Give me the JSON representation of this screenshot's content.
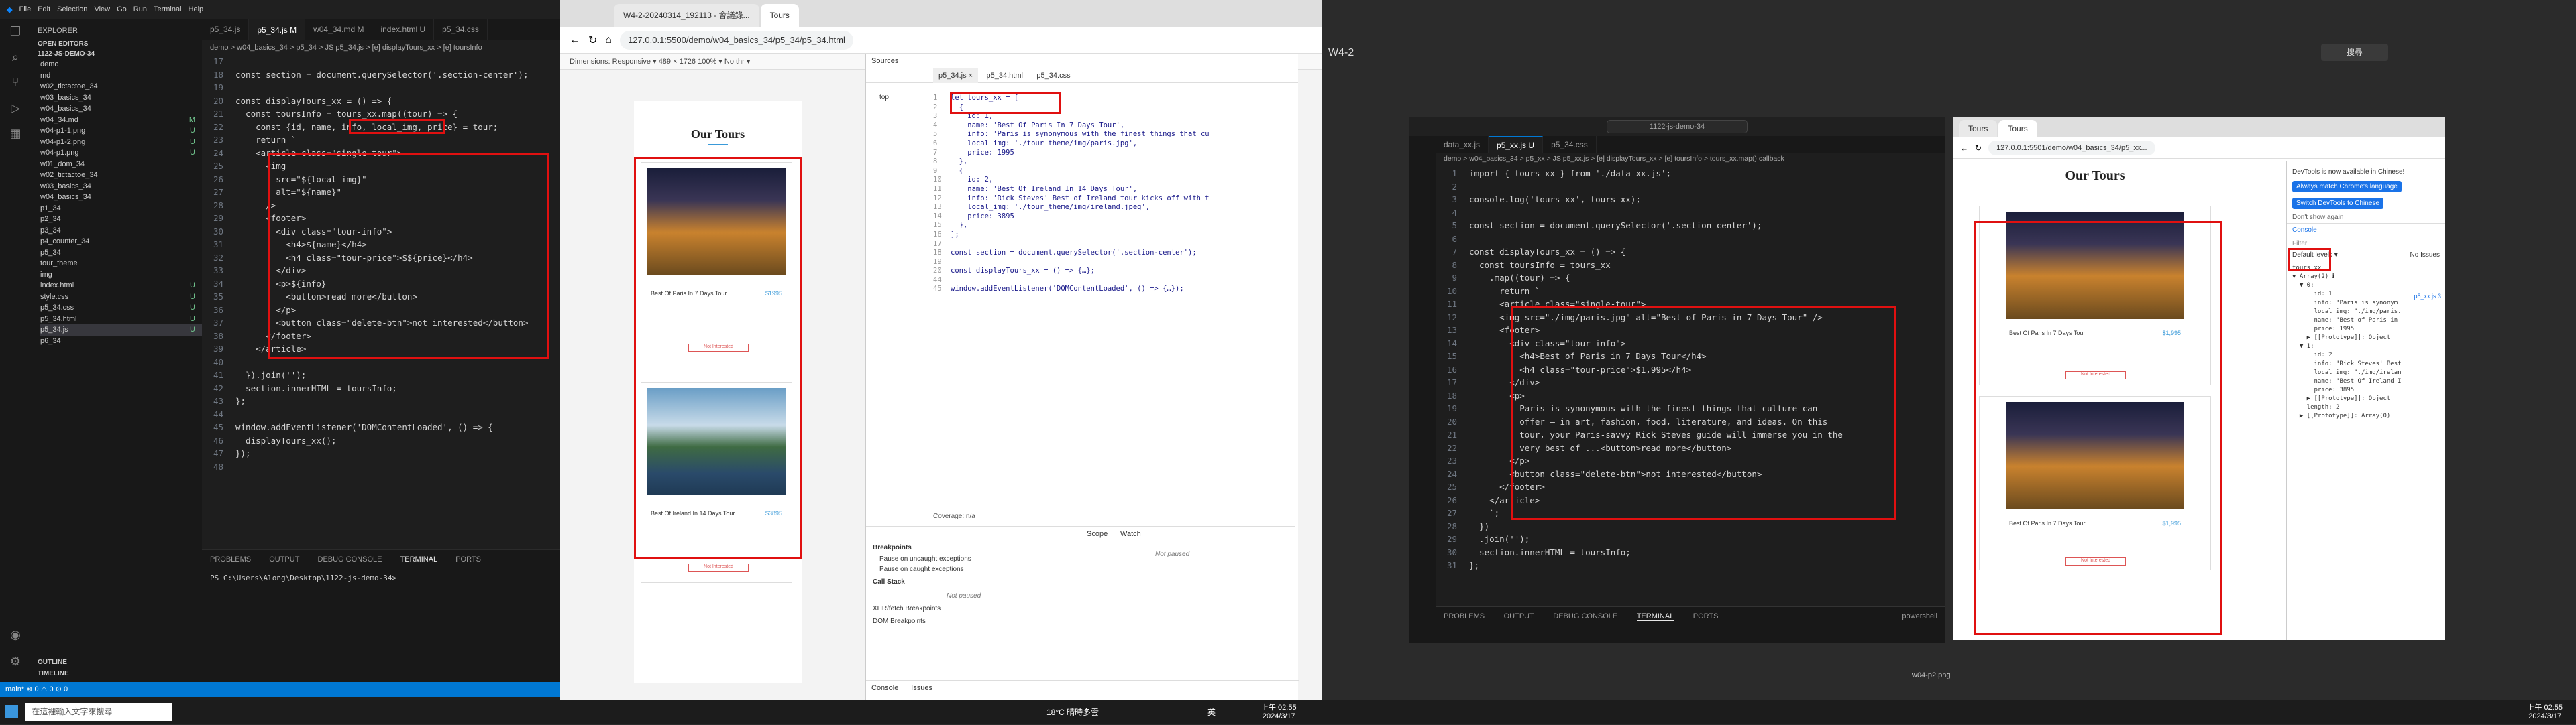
{
  "left_vscode": {
    "menu": [
      "File",
      "Edit",
      "Selection",
      "View",
      "Go",
      "Run",
      "Terminal",
      "Help"
    ],
    "explorer_title": "EXPLORER",
    "open_editors": "OPEN EDITORS",
    "workspace": "1122-JS-DEMO-34",
    "tree": [
      {
        "name": "demo",
        "status": ""
      },
      {
        "name": "md",
        "status": ""
      },
      {
        "name": "w02_tictactoe_34",
        "status": ""
      },
      {
        "name": "w03_basics_34",
        "status": ""
      },
      {
        "name": "w04_basics_34",
        "status": ""
      },
      {
        "name": "w04_34.md",
        "status": "M"
      },
      {
        "name": "w04-p1-1.png",
        "status": "U"
      },
      {
        "name": "w04-p1-2.png",
        "status": "U"
      },
      {
        "name": "w04-p1.png",
        "status": "U"
      },
      {
        "name": "w01_dom_34",
        "status": ""
      },
      {
        "name": "w02_tictactoe_34",
        "status": ""
      },
      {
        "name": "w03_basics_34",
        "status": ""
      },
      {
        "name": "w04_basics_34",
        "status": ""
      },
      {
        "name": "p1_34",
        "status": ""
      },
      {
        "name": "p2_34",
        "status": ""
      },
      {
        "name": "p3_34",
        "status": ""
      },
      {
        "name": "p4_counter_34",
        "status": ""
      },
      {
        "name": "p5_34",
        "status": ""
      },
      {
        "name": "tour_theme",
        "status": ""
      },
      {
        "name": "img",
        "status": ""
      },
      {
        "name": "index.html",
        "status": "U"
      },
      {
        "name": "style.css",
        "status": "U"
      },
      {
        "name": "p5_34.css",
        "status": "U"
      },
      {
        "name": "p5_34.html",
        "status": "U"
      },
      {
        "name": "p5_34.js",
        "status": "U"
      },
      {
        "name": "p6_34",
        "status": ""
      }
    ],
    "outline": "OUTLINE",
    "timeline": "TIMELINE",
    "tabs": [
      "p5_34.js",
      "p5_34.js M",
      "w04_34.md M",
      "index.html U",
      "p5_34.css"
    ],
    "breadcrumb": "demo > w04_basics_34 > p5_34 > JS p5_34.js > [e] displayTours_xx > [e] toursInfo",
    "code": [
      {
        "n": "17",
        "t": ""
      },
      {
        "n": "18",
        "t": "const section = document.querySelector('.section-center');"
      },
      {
        "n": "19",
        "t": ""
      },
      {
        "n": "20",
        "t": "const displayTours_xx = () => {"
      },
      {
        "n": "21",
        "t": "  const toursInfo = tours_xx.map((tour) => {"
      },
      {
        "n": "22",
        "t": "    const {id, name, info, local_img, price} = tour;"
      },
      {
        "n": "23",
        "t": "    return `"
      },
      {
        "n": "24",
        "t": "    <article class=\"single-tour\">"
      },
      {
        "n": "25",
        "t": "      <img"
      },
      {
        "n": "26",
        "t": "        src=\"${local_img}\""
      },
      {
        "n": "27",
        "t": "        alt=\"${name}\""
      },
      {
        "n": "28",
        "t": "      />"
      },
      {
        "n": "29",
        "t": "      <footer>"
      },
      {
        "n": "30",
        "t": "        <div class=\"tour-info\">"
      },
      {
        "n": "31",
        "t": "          <h4>${name}</h4>"
      },
      {
        "n": "32",
        "t": "          <h4 class=\"tour-price\">$${price}</h4>"
      },
      {
        "n": "33",
        "t": "        </div>"
      },
      {
        "n": "34",
        "t": "        <p>${info}"
      },
      {
        "n": "35",
        "t": "          <button>read more</button>"
      },
      {
        "n": "36",
        "t": "        </p>"
      },
      {
        "n": "37",
        "t": "        <button class=\"delete-btn\">not interested</button>"
      },
      {
        "n": "38",
        "t": "      </footer>"
      },
      {
        "n": "39",
        "t": "    </article>"
      },
      {
        "n": "40",
        "t": ""
      },
      {
        "n": "41",
        "t": "  }).join('');"
      },
      {
        "n": "42",
        "t": "  section.innerHTML = toursInfo;"
      },
      {
        "n": "43",
        "t": "};"
      },
      {
        "n": "44",
        "t": ""
      },
      {
        "n": "45",
        "t": "window.addEventListener('DOMContentLoaded', () => {"
      },
      {
        "n": "46",
        "t": "  displayTours_xx();"
      },
      {
        "n": "47",
        "t": "});"
      },
      {
        "n": "48",
        "t": ""
      }
    ],
    "panel_tabs": [
      "PROBLEMS",
      "OUTPUT",
      "DEBUG CONSOLE",
      "TERMINAL",
      "PORTS"
    ],
    "terminal": "PS C:\\Users\\Along\\Desktop\\1122-js-demo-34>",
    "status": "main*  ⊗ 0 ⚠ 0  ⊙ 0"
  },
  "browser1": {
    "tabs": [
      "W4-2-20240314_192113 - 會議錄...",
      "Tours"
    ],
    "url": "127.0.0.1:5500/demo/w04_basics_34/p5_34/p5_34.html",
    "device_toolbar": "Dimensions: Responsive ▾   489   ×   1726   100% ▾   No thr ▾",
    "page_title": "Our Tours",
    "card1": {
      "title": "Best Of Paris In 7 Days Tour",
      "price": "$1995",
      "button": "Not Interested"
    },
    "card2": {
      "title": "Best Of Ireland In 14 Days Tour",
      "price": "$3895",
      "button": "Not Interested"
    },
    "devtools": {
      "tabs": [
        "Sources"
      ],
      "file_tabs": [
        "p5_34.js ×",
        "p5_34.html",
        "p5_34.css"
      ],
      "nav_item": "top",
      "code": [
        {
          "n": "1",
          "t": "let tours_xx = ["
        },
        {
          "n": "2",
          "t": "  {"
        },
        {
          "n": "3",
          "t": "    id: 1,"
        },
        {
          "n": "4",
          "t": "    name: 'Best Of Paris In 7 Days Tour',"
        },
        {
          "n": "5",
          "t": "    info: 'Paris is synonymous with the finest things that cu"
        },
        {
          "n": "6",
          "t": "    local_img: './tour_theme/img/paris.jpg',"
        },
        {
          "n": "7",
          "t": "    price: 1995"
        },
        {
          "n": "8",
          "t": "  },"
        },
        {
          "n": "9",
          "t": "  {"
        },
        {
          "n": "10",
          "t": "    id: 2,"
        },
        {
          "n": "11",
          "t": "    name: 'Best Of Ireland In 14 Days Tour',"
        },
        {
          "n": "12",
          "t": "    info: 'Rick Steves' Best of Ireland tour kicks off with t"
        },
        {
          "n": "13",
          "t": "    local_img: './tour_theme/img/ireland.jpeg',"
        },
        {
          "n": "14",
          "t": "    price: 3895"
        },
        {
          "n": "15",
          "t": "  },"
        },
        {
          "n": "16",
          "t": "];"
        },
        {
          "n": "17",
          "t": ""
        },
        {
          "n": "18",
          "t": "const section = document.querySelector('.section-center');"
        },
        {
          "n": "19",
          "t": ""
        },
        {
          "n": "20",
          "t": "const displayTours_xx = () => {…};"
        },
        {
          "n": "44",
          "t": ""
        },
        {
          "n": "45",
          "t": "window.addEventListener('DOMContentLoaded', () => {…});"
        }
      ],
      "coverage": "Coverage: n/a",
      "debug_tabs": [
        "Scope",
        "Watch"
      ],
      "not_paused": "Not paused",
      "breakpoints": "Breakpoints",
      "pause_uncaught": "Pause on uncaught exceptions",
      "pause_caught": "Pause on caught exceptions",
      "call_stack": "Call Stack",
      "xhr": "XHR/fetch Breakpoints",
      "dom_bp": "DOM Breakpoints",
      "console_tabs": [
        "Console",
        "Issues"
      ]
    }
  },
  "right_vscode": {
    "search": "1122-js-demo-34",
    "tabs": [
      "data_xx.js",
      "p5_xx.js U",
      "p5_34.css"
    ],
    "breadcrumb": "demo > w04_basics_34 > p5_xx > JS p5_xx.js > [e] displayTours_xx > [e] toursInfo > tours_xx.map() callback",
    "code": [
      {
        "n": "1",
        "t": "import { tours_xx } from './data_xx.js';"
      },
      {
        "n": "2",
        "t": ""
      },
      {
        "n": "3",
        "t": "console.log('tours_xx', tours_xx);"
      },
      {
        "n": "4",
        "t": ""
      },
      {
        "n": "5",
        "t": "const section = document.querySelector('.section-center');"
      },
      {
        "n": "6",
        "t": ""
      },
      {
        "n": "7",
        "t": "const displayTours_xx = () => {"
      },
      {
        "n": "8",
        "t": "  const toursInfo = tours_xx"
      },
      {
        "n": "9",
        "t": "    .map((tour) => {"
      },
      {
        "n": "10",
        "t": "      return `"
      },
      {
        "n": "11",
        "t": "      <article class=\"single-tour\">"
      },
      {
        "n": "12",
        "t": "      <img src=\"./img/paris.jpg\" alt=\"Best of Paris in 7 Days Tour\" />"
      },
      {
        "n": "13",
        "t": "      <footer>"
      },
      {
        "n": "14",
        "t": "        <div class=\"tour-info\">"
      },
      {
        "n": "15",
        "t": "          <h4>Best of Paris in 7 Days Tour</h4>"
      },
      {
        "n": "16",
        "t": "          <h4 class=\"tour-price\">$1,995</h4>"
      },
      {
        "n": "17",
        "t": "        </div>"
      },
      {
        "n": "18",
        "t": "        <p>"
      },
      {
        "n": "19",
        "t": "          Paris is synonymous with the finest things that culture can"
      },
      {
        "n": "20",
        "t": "          offer — in art, fashion, food, literature, and ideas. On this"
      },
      {
        "n": "21",
        "t": "          tour, your Paris-savvy Rick Steves guide will immerse you in the"
      },
      {
        "n": "22",
        "t": "          very best of ...<button>read more</button>"
      },
      {
        "n": "23",
        "t": "        </p>"
      },
      {
        "n": "24",
        "t": "        <button class=\"delete-btn\">not interested</button>"
      },
      {
        "n": "25",
        "t": "      </footer>"
      },
      {
        "n": "26",
        "t": "    </article>"
      },
      {
        "n": "27",
        "t": "    `;"
      },
      {
        "n": "28",
        "t": "  })"
      },
      {
        "n": "29",
        "t": "  .join('');"
      },
      {
        "n": "30",
        "t": "  section.innerHTML = toursInfo;"
      },
      {
        "n": "31",
        "t": "};"
      }
    ],
    "panel_tabs": [
      "PROBLEMS",
      "OUTPUT",
      "DEBUG CONSOLE",
      "TERMINAL",
      "PORTS"
    ],
    "terminal_shell": "powershell"
  },
  "browser2": {
    "tabs": [
      "Tours",
      "Tours"
    ],
    "url": "127.0.0.1:5501/demo/w04_basics_34/p5_xx...",
    "page_title": "Our Tours",
    "card1": {
      "title": "Best Of Paris In 7 Days Tour",
      "price": "$1,995",
      "button": "Not Interested"
    },
    "card2": {
      "title": "Best Of Paris In 7 Days Tour",
      "price": "$1,995",
      "button": "Not Interested"
    },
    "devtools_notice": "DevTools is now available in Chinese!",
    "btn_lang": "Always match Chrome's language",
    "btn_switch": "Switch DevTools to Chinese",
    "dont_show": "Don't show again",
    "console_tab": "Console",
    "filter": "Filter",
    "levels": "Default levels ▾",
    "issues": "No Issues",
    "console_log": [
      "tours_xx",
      "▼ Array(2) ℹ",
      "  ▼ 0:",
      "      id: 1",
      "      info: \"Paris is synonym",
      "      local_img: \"./img/paris.",
      "      name: \"Best of Paris in",
      "      price: 1995",
      "    ▶ [[Prototype]]: Object",
      "  ▼ 1:",
      "      id: 2",
      "      info: \"Rick Steves' Best",
      "      local_img: \"./img/irelan",
      "      name: \"Best Of Ireland I",
      "      price: 3895",
      "    ▶ [[Prototype]]: Object",
      "    length: 2",
      "  ▶ [[Prototype]]: Array(0)"
    ],
    "console_src": "p5_xx.js:3"
  },
  "top_right": {
    "label": "W4-2",
    "search": "搜尋"
  },
  "caption": "w04-p2.png",
  "taskbar": {
    "search": "在這裡輸入文字來搜尋",
    "weather": "18°C 晴時多雲",
    "lang": "英",
    "time": "上午 02:55",
    "date": "2024/3/17"
  }
}
